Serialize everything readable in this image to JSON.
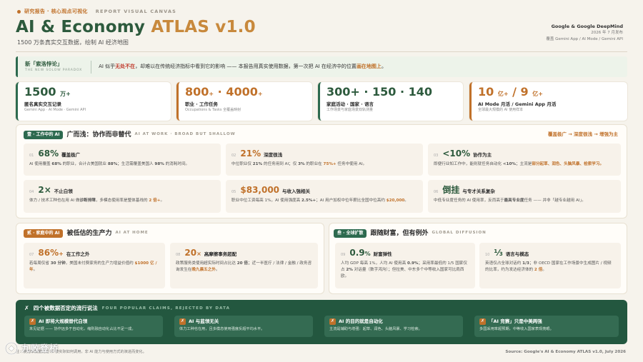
{
  "header": {
    "tag": "研究报告 · 核心观点可视化",
    "tag_en": "REPORT VISUAL CANVAS",
    "title_main": "AI & Economy",
    "title_version": "ATLAS v1.0",
    "subtitle": "1500 万条真实交互数据，绘制 AI 经济地图",
    "org": "Google & Google DeepMind",
    "date": "2026 年 7 月发布",
    "scope": "覆盖 Gemini App / AI Mode / Gemini API"
  },
  "paradox": {
    "title": "新「索洛悖论」",
    "title_en": "THE NEW SOLOW PARADOX",
    "text_a": "AI 似乎",
    "text_b": "无处不在",
    "text_c": "，却难以在传统经济指标中看到它的影响 —— 本报告用真实使用数据，第一次把 AI 在经济中的位置",
    "text_d": "画在地图上",
    "text_e": "。"
  },
  "stats": [
    {
      "num": "1500",
      "unit": "万+",
      "label": "匿名真实交互记录",
      "sub": "Gemini App · AI Mode · Gemini API"
    },
    {
      "num": "800",
      "unit": "+",
      "num2": "4000",
      "unit2": "+",
      "sep": " · ",
      "label": "职业 · 工作任务",
      "sub": "Occupations & Tasks 全覆盖映射"
    },
    {
      "num": "300+ · 150 · 140",
      "label": "家庭活动 · 国家 · 语言",
      "sub": "工作场景与家庭场景双轨测量"
    },
    {
      "num": "10",
      "unit": "亿+",
      "num2": "9",
      "unit2": "亿+",
      "sep": " / ",
      "label": "AI Mode 月活 / Gemini App 月活",
      "sub": "全球最大规模的 AI 使用样本"
    }
  ],
  "work": {
    "pill": "壹 · 工作中的 AI",
    "title": "广而浅：协作而非替代",
    "en": "AI AT WORK · BROAD BUT SHALLOW",
    "flow": "覆盖极广 → 深度很浅 → 增强为主",
    "cards": [
      {
        "n": "01",
        "big": "68%",
        "title": "覆盖极广",
        "desc_a": "AI 使用覆盖 ",
        "desc_b": "68%",
        "desc_c": " 的职业，合计占美国就业 ",
        "desc_d": "88%",
        "desc_e": "；生活需覆盖美国人 ",
        "desc_f": "98%",
        "desc_g": " 的消耗时间。"
      },
      {
        "n": "02",
        "big": "21%",
        "title": "深度很浅",
        "desc_a": "中位职业仅 ",
        "desc_b": "21%",
        "desc_c": " 的任务用到 AI；仅 ",
        "desc_d": "3%",
        "desc_e": " 的职业在 ",
        "desc_f": "75%+",
        "desc_g": " 任务中使用 AI。"
      },
      {
        "n": "03",
        "big": "<10%",
        "title": "协作为主",
        "desc_a": "即便行业知工作中，能则就任务自动化 ",
        "desc_b": "<10%",
        "desc_c": "；主流是",
        "desc_d": "部分起草、润色、头脑风暴、检索学习。",
        "desc_e": "",
        "desc_f": "",
        "desc_g": ""
      },
      {
        "n": "04",
        "big": "2×",
        "title": "不止白领",
        "desc_a": "体力 / 技术工种也在用 AI 做",
        "desc_b": "诊断排障",
        "desc_c": "，多模态使用率是整体基线的 ",
        "desc_d": "2 倍+",
        "desc_e": "。",
        "desc_f": "",
        "desc_g": ""
      },
      {
        "n": "05",
        "big": "$83,000",
        "title": "与收入强相关",
        "desc_a": "职业中位工资每高 1%，AI 使用强度高 ",
        "desc_b": "2.5%+",
        "desc_c": "；AI 用户加权中位年薪比全国中位高约 ",
        "desc_d": "$20,000",
        "desc_e": "。",
        "desc_f": "",
        "desc_g": ""
      },
      {
        "n": "06",
        "big": "倒挂",
        "title": "与专才关系复杂",
        "desc_a": "中低专业度任务的 AI 使用率，反而高于",
        "desc_b": "最高专业度",
        "desc_c": "任务 —— 并非「越专业越用 AI」。",
        "desc_d": "",
        "desc_e": "",
        "desc_f": "",
        "desc_g": ""
      }
    ]
  },
  "home": {
    "pill": "贰 · 家庭中的 AI",
    "title": "被低估的生产力",
    "en": "AI AT HOME",
    "cards": [
      {
        "n": "07",
        "big": "86%",
        "unit": "+",
        "title": "在工作之外",
        "desc_a": "若每周仅省 ",
        "desc_b": "30 分钟",
        "desc_c": "，美国未付费家务的生产力增益价值约 ",
        "desc_d": "$1000 亿 / 年",
        "desc_e": "。"
      },
      {
        "n": "08",
        "big": "20",
        "unit": "×",
        "title": "高摩擦事务超配",
        "desc_a": "政策服务类使用超实际时间占比达 ",
        "desc_b": "20 倍",
        "desc_c": "；近一半医疗 / 法律 / 金融 / 政务咨询发生在",
        "desc_d": "晚九晨五之外",
        "desc_e": "。"
      }
    ]
  },
  "global": {
    "pill": "叁 · 全球扩散",
    "title": "跟随财富，但有例外",
    "en": "GLOBAL DIFFUSION",
    "cards": [
      {
        "n": "09",
        "big": "0.9",
        "unit": "%",
        "title": "财富弹性",
        "desc_a": "人均 GDP 每高 1%，人均 AI 使用高 ",
        "desc_b": "0.9%",
        "desc_c": "；采用率最低的 1/5 国家仅占 ",
        "desc_d": "2%",
        "desc_e": " 对话量（数字鸿沟）；但拉美、中东多个中等收入国家可比肩西欧。"
      },
      {
        "n": "10",
        "big": "⅓",
        "unit": "",
        "title": "语言与模态",
        "desc_a": "英语仅占全球对话约 ",
        "desc_b": "1/3",
        "desc_c": "；非 OECD 国家在工作场景中生成图片 / 视频的比率，约为发达经济体的 ",
        "desc_d": "2 倍",
        "desc_e": "。"
      }
    ]
  },
  "myths": {
    "title": "四个被数据否定的流行说法",
    "en": "FOUR POPULAR CLAIMS, REJECTED BY DATA",
    "items": [
      {
        "title": "AI 即将大规模替代白领",
        "desc": "未见证据 —— 协作远多于自动化，缩则融自动化占比不足一成。"
      },
      {
        "title": "AI 与蓝领无关",
        "desc": "体力工种也在用，且多模态使用强度反超平均水平。"
      },
      {
        "title": "AI 的目的就是自动化",
        "desc": "主流是辅助与增强：起草、润色、头脑风暴、学习检索。"
      },
      {
        "title": "「AI 竞赛」只是中美两强",
        "desc": "多国采用率超预期，中等收入国家表现亮眼。"
      }
    ]
  },
  "footer": {
    "left": "注：使用率衡量的是 AI 被实际如何调用，非 AI 能力与使用方式的演进而变化。",
    "right": "Source: Google's AI & Economy ATLAS v1.0, July 2026"
  },
  "watermark": {
    "text": "九败登桥"
  }
}
